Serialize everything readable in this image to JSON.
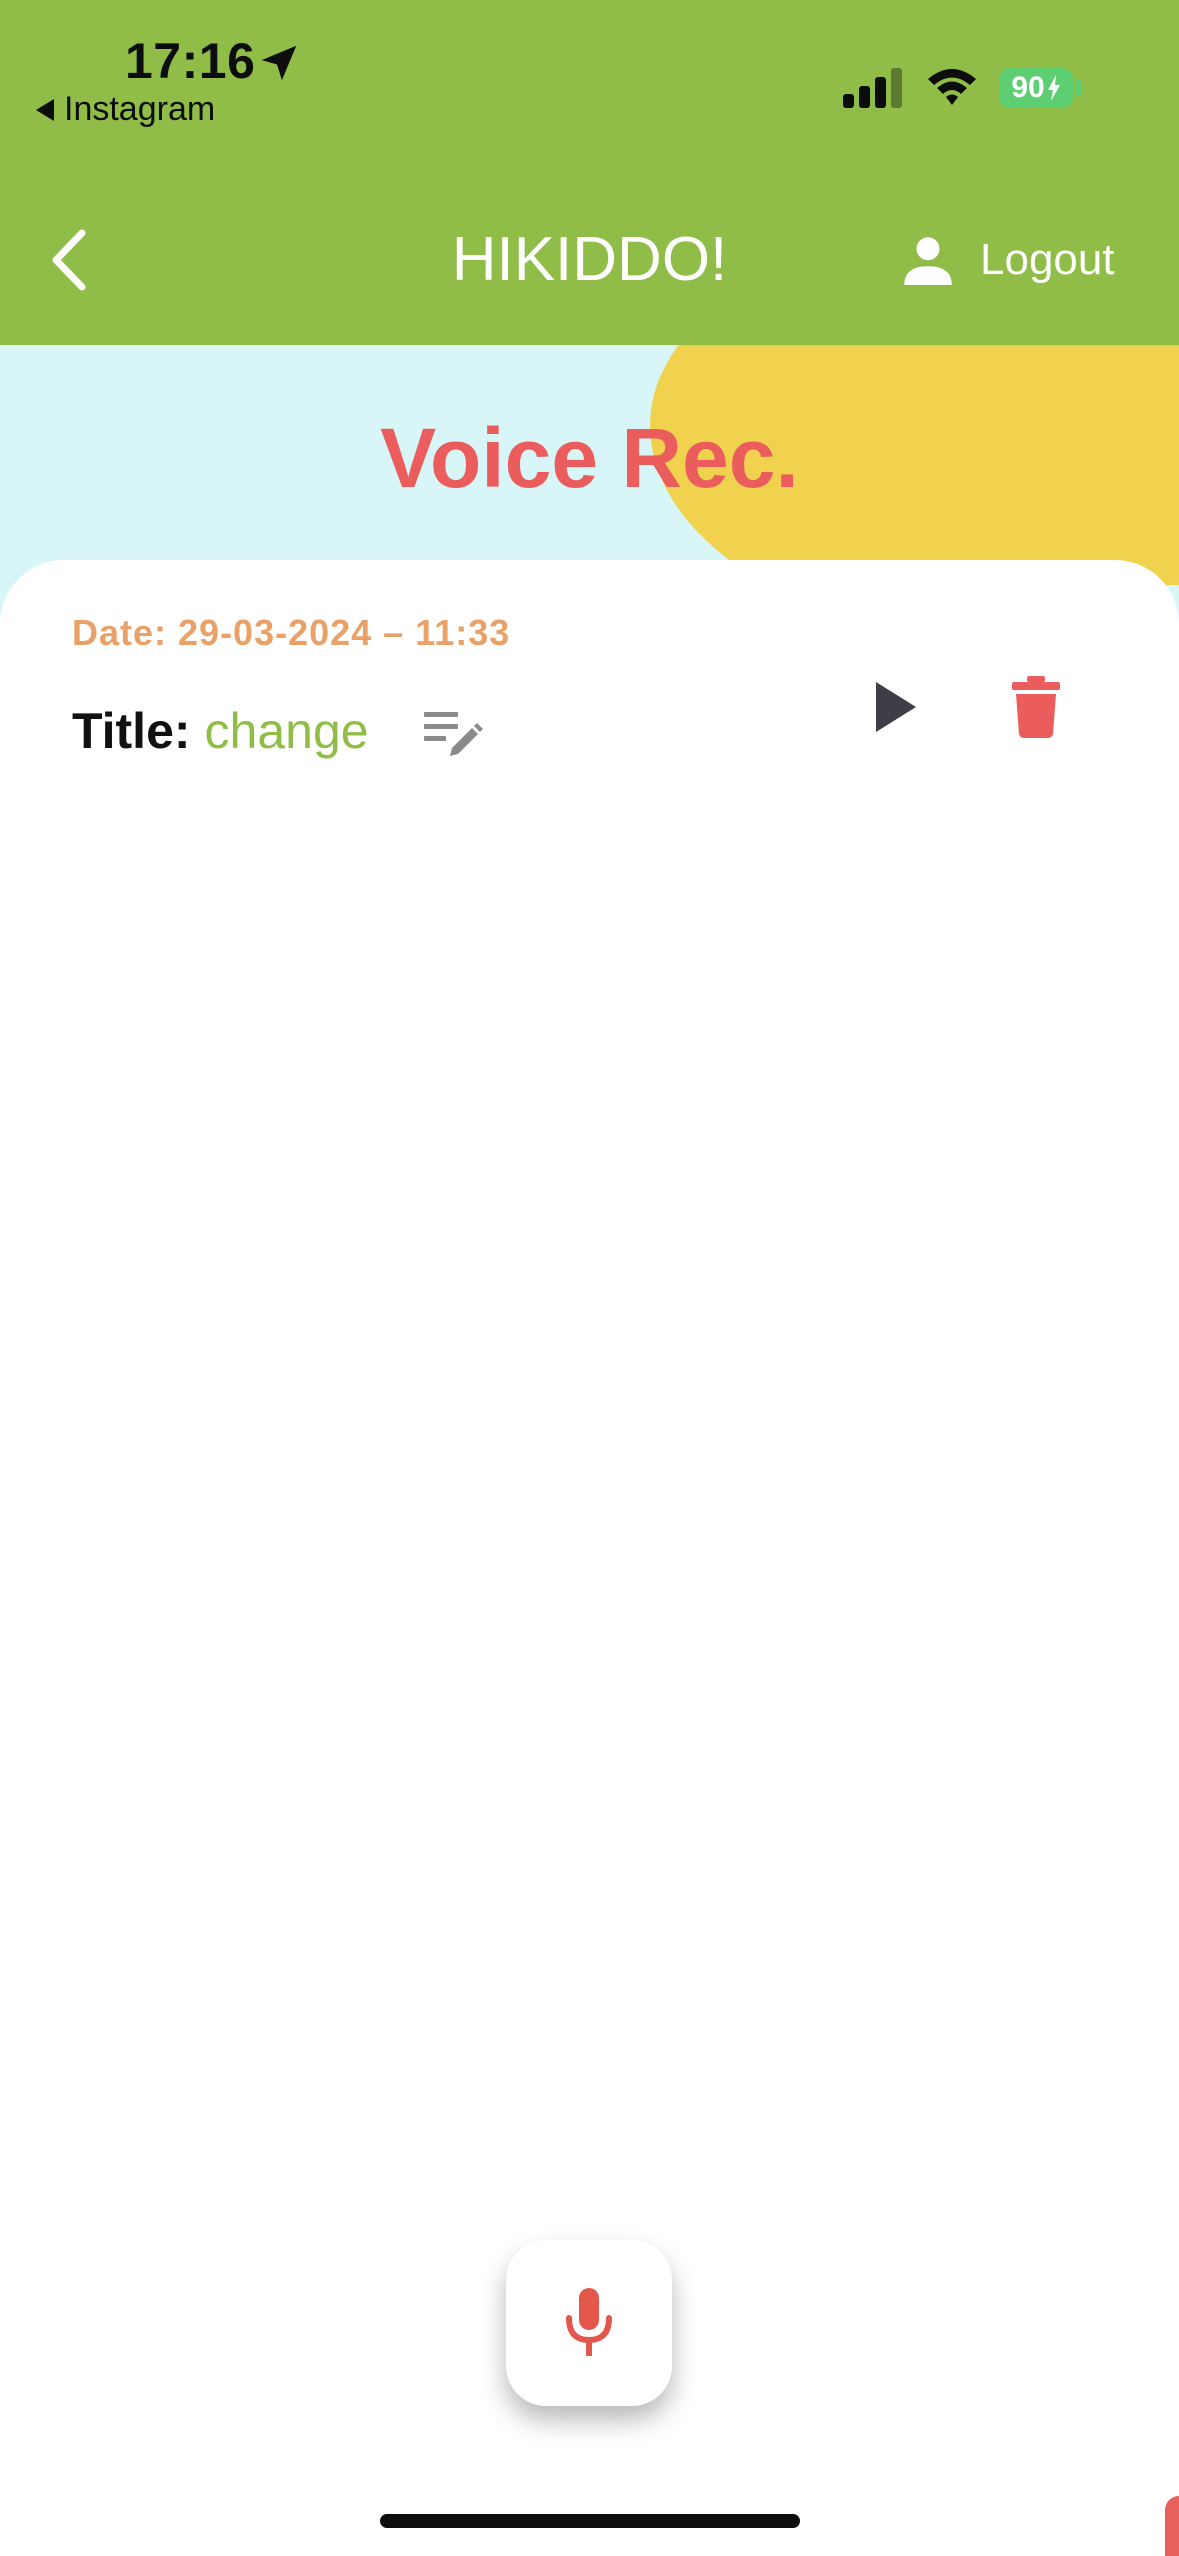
{
  "status_bar": {
    "time": "17:16",
    "back_app": "Instagram",
    "battery": "90"
  },
  "app_bar": {
    "title": "HIKIDDO!",
    "logout_label": "Logout"
  },
  "page": {
    "heading": "Voice Rec."
  },
  "recording": {
    "date": "Date: 29-03-2024 – 11:33",
    "title_label": "Title:",
    "title_value": "change"
  },
  "icons": {
    "location": "location-arrow-icon",
    "signal": "cellular-signal-icon",
    "wifi": "wifi-icon",
    "battery": "battery-charging-icon",
    "back": "chevron-left-icon",
    "person": "person-icon",
    "edit": "edit-note-icon",
    "play": "play-icon",
    "delete": "trash-icon",
    "mic": "microphone-icon"
  },
  "colors": {
    "app_bar": "#8fbd47",
    "hero_background": "#d8f6f8",
    "blob": "#f1d24f",
    "heading": "#eb5d5d",
    "date": "#eaa167",
    "title_value": "#8fbd47",
    "delete": "#eb5d5d",
    "mic": "#e4574b"
  }
}
